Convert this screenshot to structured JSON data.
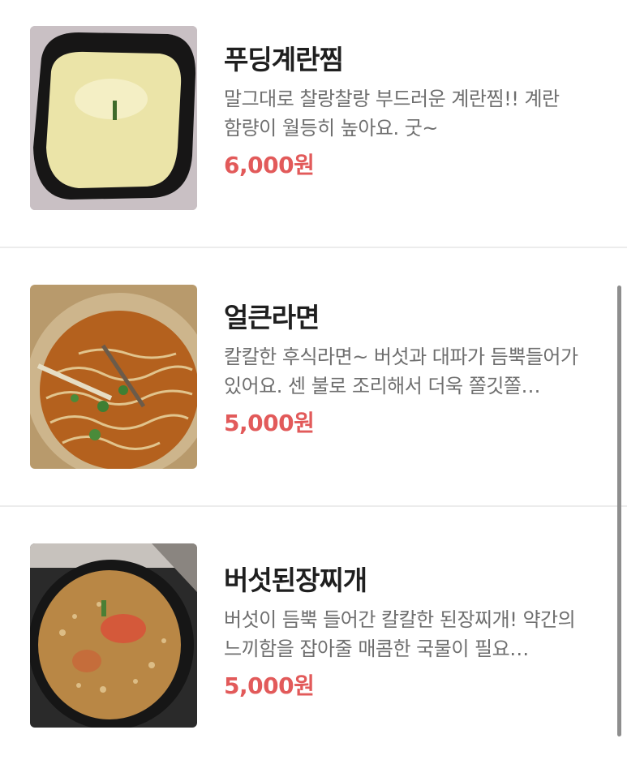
{
  "menu": {
    "items": [
      {
        "name": "푸딩계란찜",
        "description": "말그대로 찰랑찰랑 부드러운 계란찜!! 계란 함량이 월등히 높아요. 굿~",
        "price": "6,000원",
        "image_icon": "steamed-egg-photo"
      },
      {
        "name": "얼큰라면",
        "description": "칼칼한 후식라면~ 버섯과 대파가 듬뿍들어가 있어요. 센 불로 조리해서 더욱 쫄깃쫄…",
        "price": "5,000원",
        "image_icon": "ramen-photo"
      },
      {
        "name": "버섯된장찌개",
        "description": "버섯이 듬뿍 들어간 칼칼한 된장찌개! 약간의 느끼함을 잡아줄 매콤한 국물이 필요…",
        "price": "5,000원",
        "image_icon": "doenjang-stew-photo"
      }
    ]
  },
  "colors": {
    "price": "#e25a5a",
    "name": "#1f1f1f",
    "description": "#6f6f6f",
    "divider": "#ececec"
  }
}
